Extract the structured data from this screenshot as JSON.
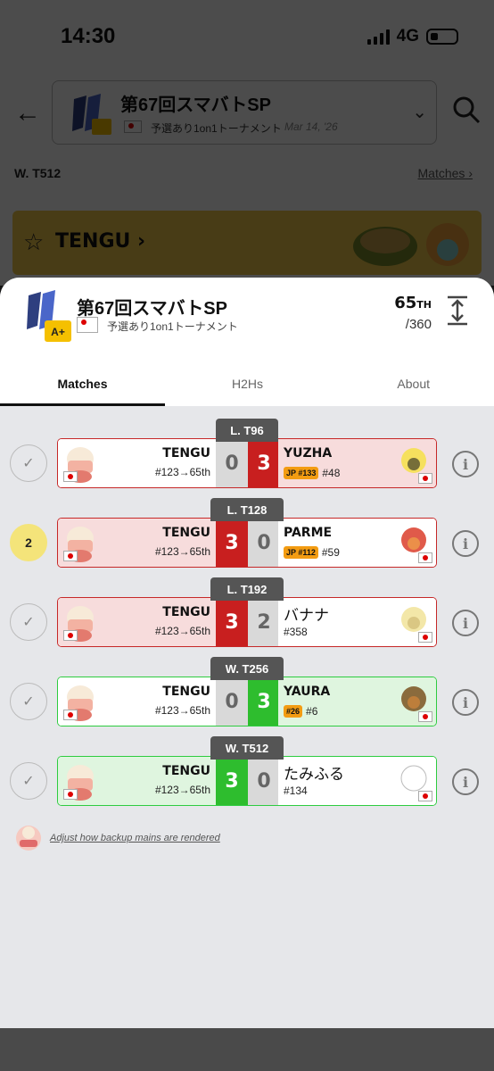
{
  "status_bar": {
    "time": "14:30",
    "network": "4G"
  },
  "header": {
    "event_title": "第67回スマバトSP",
    "event_subtitle": "予選あり1on1トーナメント",
    "event_date": "Mar 14, '26",
    "tier_badge": "A+"
  },
  "background": {
    "section_label": "W. T512",
    "matches_link": "Matches",
    "player_banner": "TENGU"
  },
  "sheet": {
    "title": "第67回スマバトSP",
    "subtitle": "予選あり1on1トーナメント",
    "tier_badge": "A+",
    "rank": "65",
    "rank_suffix": "TH",
    "rank_total": "/360",
    "tabs": [
      {
        "label": "Matches",
        "active": true
      },
      {
        "label": "H2Hs",
        "active": false
      },
      {
        "label": "About",
        "active": false
      }
    ]
  },
  "matches": [
    {
      "round": "L. T96",
      "status": "done",
      "player": {
        "name": "TENGU",
        "seed": "#123→65th",
        "score": "0"
      },
      "opponent": {
        "name": "YUZHA",
        "badge": "JP #133",
        "seed": "#48",
        "score": "3"
      },
      "result": "loss"
    },
    {
      "round": "L. T128",
      "status": "pending",
      "status_number": "2",
      "player": {
        "name": "TENGU",
        "seed": "#123→65th",
        "score": "3"
      },
      "opponent": {
        "name": "PARME",
        "badge": "JP #112",
        "seed": "#59",
        "score": "0"
      },
      "result": "loss"
    },
    {
      "round": "L. T192",
      "status": "done",
      "player": {
        "name": "TENGU",
        "seed": "#123→65th",
        "score": "3"
      },
      "opponent": {
        "name": "バナナ",
        "badge": "",
        "seed": "#358",
        "score": "2"
      },
      "result": "loss"
    },
    {
      "round": "W. T256",
      "status": "done",
      "player": {
        "name": "TENGU",
        "seed": "#123→65th",
        "score": "0"
      },
      "opponent": {
        "name": "YAURA",
        "badge": "#26",
        "seed": "#6",
        "score": "3"
      },
      "result": "win"
    },
    {
      "round": "W. T512",
      "status": "done",
      "player": {
        "name": "TENGU",
        "seed": "#123→65th",
        "score": "3"
      },
      "opponent": {
        "name": "たみふる",
        "badge": "",
        "seed": "#134",
        "score": "0"
      },
      "result": "win"
    }
  ],
  "footer": {
    "note": "Adjust how backup mains are rendered"
  },
  "colors": {
    "loss_red": "#c81f1f",
    "win_green": "#2ebd2e",
    "banner_yellow": "#f2c94c",
    "badge_orange": "#f39c12"
  },
  "icons": [
    "back-arrow-icon",
    "search-icon",
    "chevron-down-icon",
    "star-icon",
    "chevron-right-icon",
    "expand-icon",
    "check-icon",
    "info-icon"
  ]
}
